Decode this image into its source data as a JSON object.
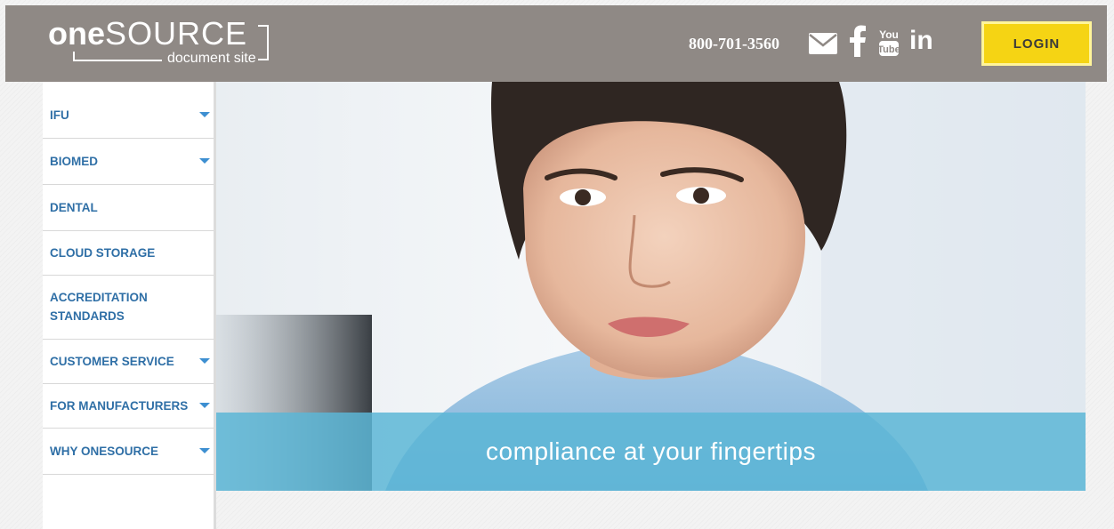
{
  "header": {
    "logo": {
      "bold": "one",
      "light": "SOURCE",
      "sub": "document site"
    },
    "phone": "800-701-3560",
    "icons": [
      "mail-icon",
      "facebook-icon",
      "youtube-icon",
      "linkedin-icon"
    ],
    "linkedin_text": "in",
    "login_label": "LOGIN",
    "colors": {
      "header_bg": "#8f8985",
      "login_bg": "#f5d414"
    }
  },
  "sidebar": {
    "items": [
      {
        "label": "IFU",
        "has_dropdown": true
      },
      {
        "label": "BIOMED",
        "has_dropdown": true
      },
      {
        "label": "DENTAL",
        "has_dropdown": false
      },
      {
        "label": "CLOUD STORAGE",
        "has_dropdown": false
      },
      {
        "label": "ACCREDITATION",
        "label2": "STANDARDS",
        "has_dropdown": false
      },
      {
        "label": "CUSTOMER SERVICE",
        "has_dropdown": true
      },
      {
        "label": "FOR MANUFACTURERS",
        "has_dropdown": true
      },
      {
        "label": "WHY ONESOURCE",
        "has_dropdown": true
      }
    ],
    "link_color": "#2f6fa6"
  },
  "hero": {
    "tagline": "compliance at your fingertips",
    "banner_color": "#5cb6d6"
  }
}
